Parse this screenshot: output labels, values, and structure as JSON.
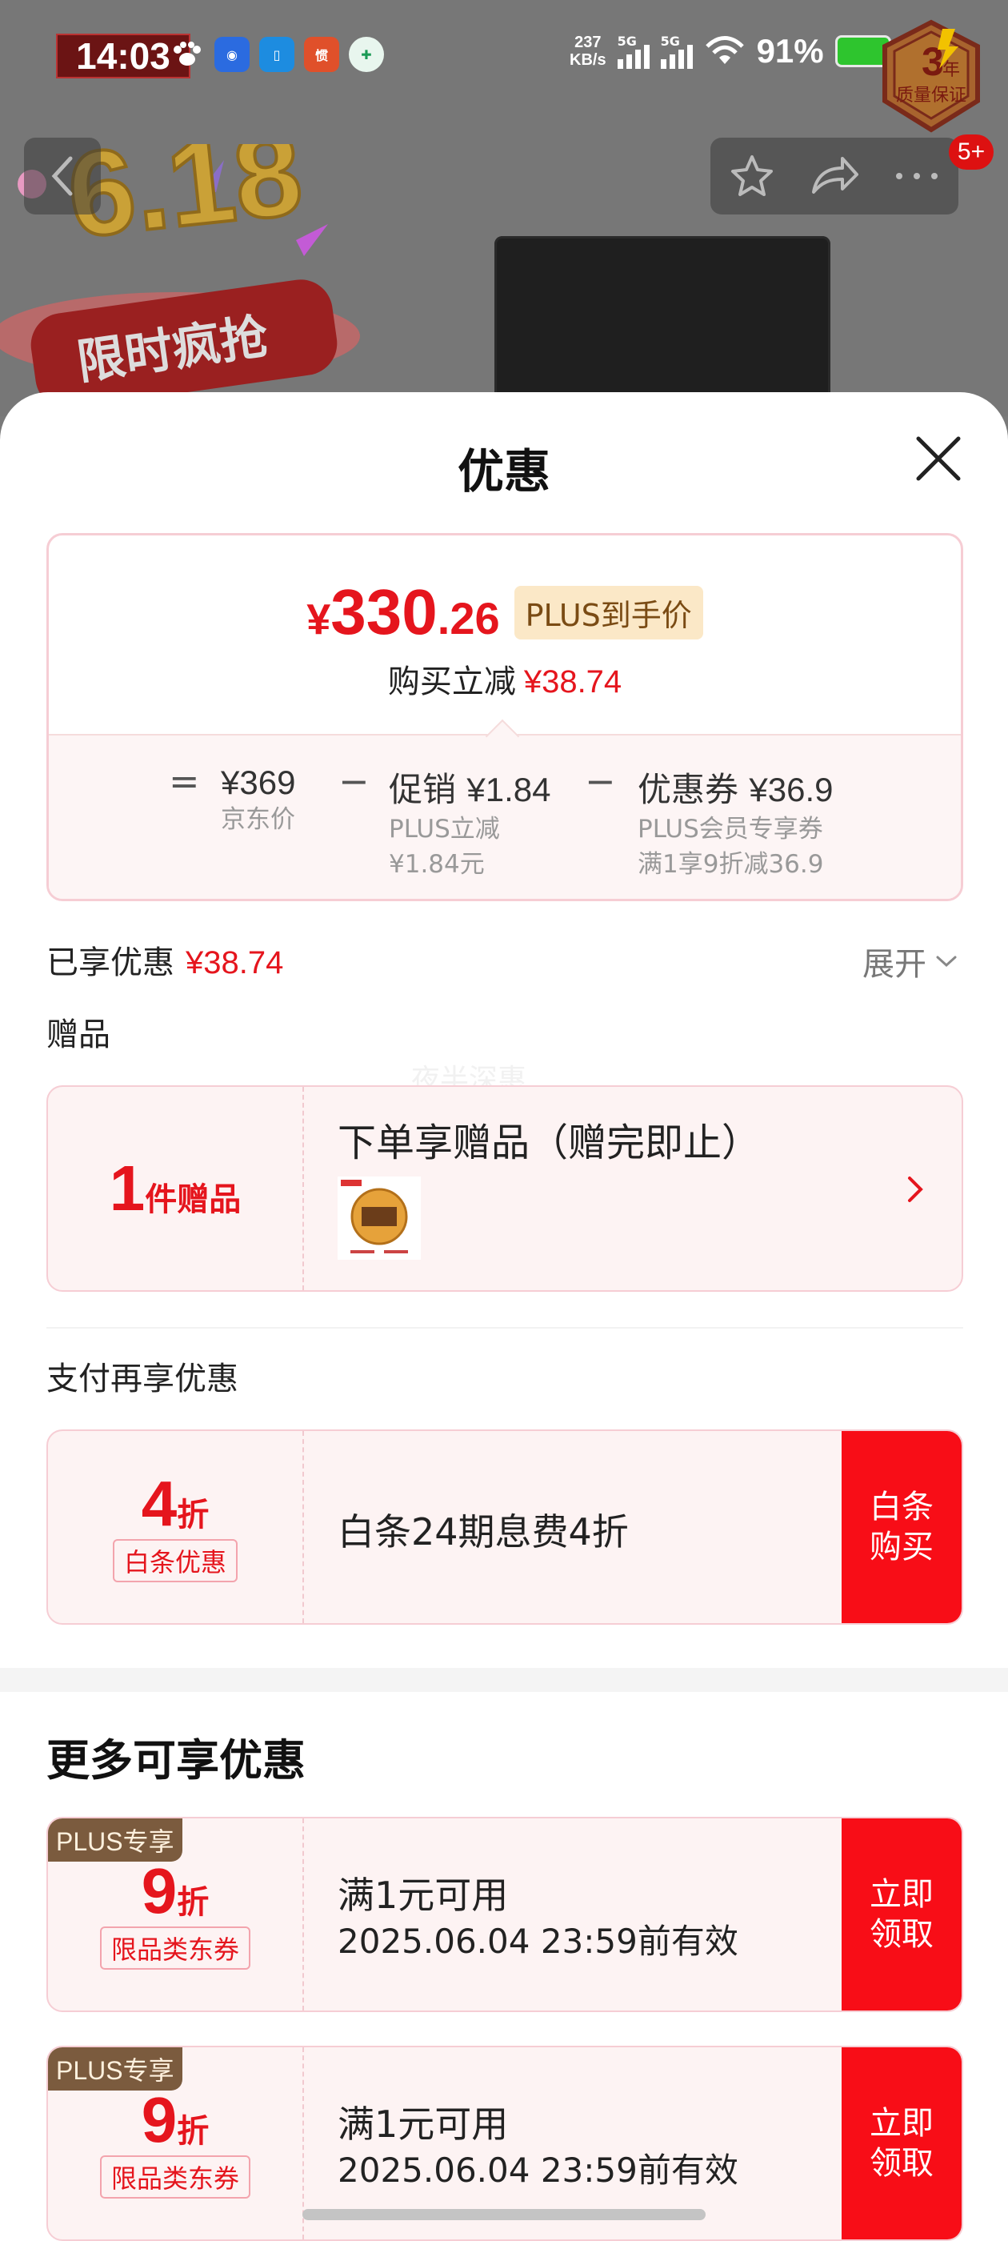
{
  "status_bar": {
    "time": "14:03",
    "net_speed_value": "237",
    "net_speed_unit": "KB/s",
    "sim1": "5G",
    "sim2": "5G",
    "battery_pct": "91%",
    "notif_count": "5+",
    "badge_num": "3",
    "badge_year": "年",
    "badge_text": "质量保证",
    "app_icons": [
      "paw-icon",
      "browser-icon",
      "phone-icon",
      "cart-icon",
      "shield-icon"
    ]
  },
  "background": {
    "promo_618": "6.18",
    "promo_text": "限时疯抢"
  },
  "sheet": {
    "title": "优惠",
    "price": {
      "currency": "¥",
      "integer": "330",
      "decimal": ".26",
      "tag": "PLUS到手价",
      "reduce_label": "购买立减",
      "reduce_value": "¥38.74"
    },
    "breakdown": {
      "equals": "=",
      "minus": "−",
      "items": [
        {
          "head": "¥369",
          "sub1": "京东价",
          "sub2": ""
        },
        {
          "head_label": "促销",
          "head": "¥1.84",
          "sub1": "PLUS立减",
          "sub2": "¥1.84元"
        },
        {
          "head_label": "优惠券",
          "head": "¥36.9",
          "sub1": "PLUS会员专享券",
          "sub2": "满1享9折减36.9"
        }
      ]
    },
    "enjoyed_label": "已享优惠",
    "enjoyed_value": "¥38.74",
    "expand_label": "展开",
    "gift_section": "赠品",
    "watermark": "夜半深惠",
    "gift": {
      "count": "1",
      "unit": "件赠品",
      "title": "下单享赠品（赠完即止）"
    },
    "pay_section": "支付再享优惠",
    "pay": {
      "num": "4",
      "unit": "折",
      "tag": "白条优惠",
      "desc": "白条24期息费4折",
      "button": "白条\n购买"
    },
    "more_title": "更多可享优惠",
    "coupons": [
      {
        "corner": "PLUS专享",
        "num": "9",
        "unit": "折",
        "tag": "限品类东券",
        "line1": "满1元可用",
        "line2": "2025.06.04 23:59前有效",
        "button": "立即\n领取"
      },
      {
        "corner": "PLUS专享",
        "num": "9",
        "unit": "折",
        "tag": "限品类东券",
        "line1": "满1元可用",
        "line2": "2025.06.04 23:59前有效",
        "button": "立即\n领取"
      }
    ]
  },
  "colors": {
    "accent_red": "#e5151d",
    "button_red": "#f80d17",
    "card_bg": "#fdf3f3",
    "plus_brown": "#7b5b3e",
    "plus_tag_bg": "#fbe8c7"
  }
}
